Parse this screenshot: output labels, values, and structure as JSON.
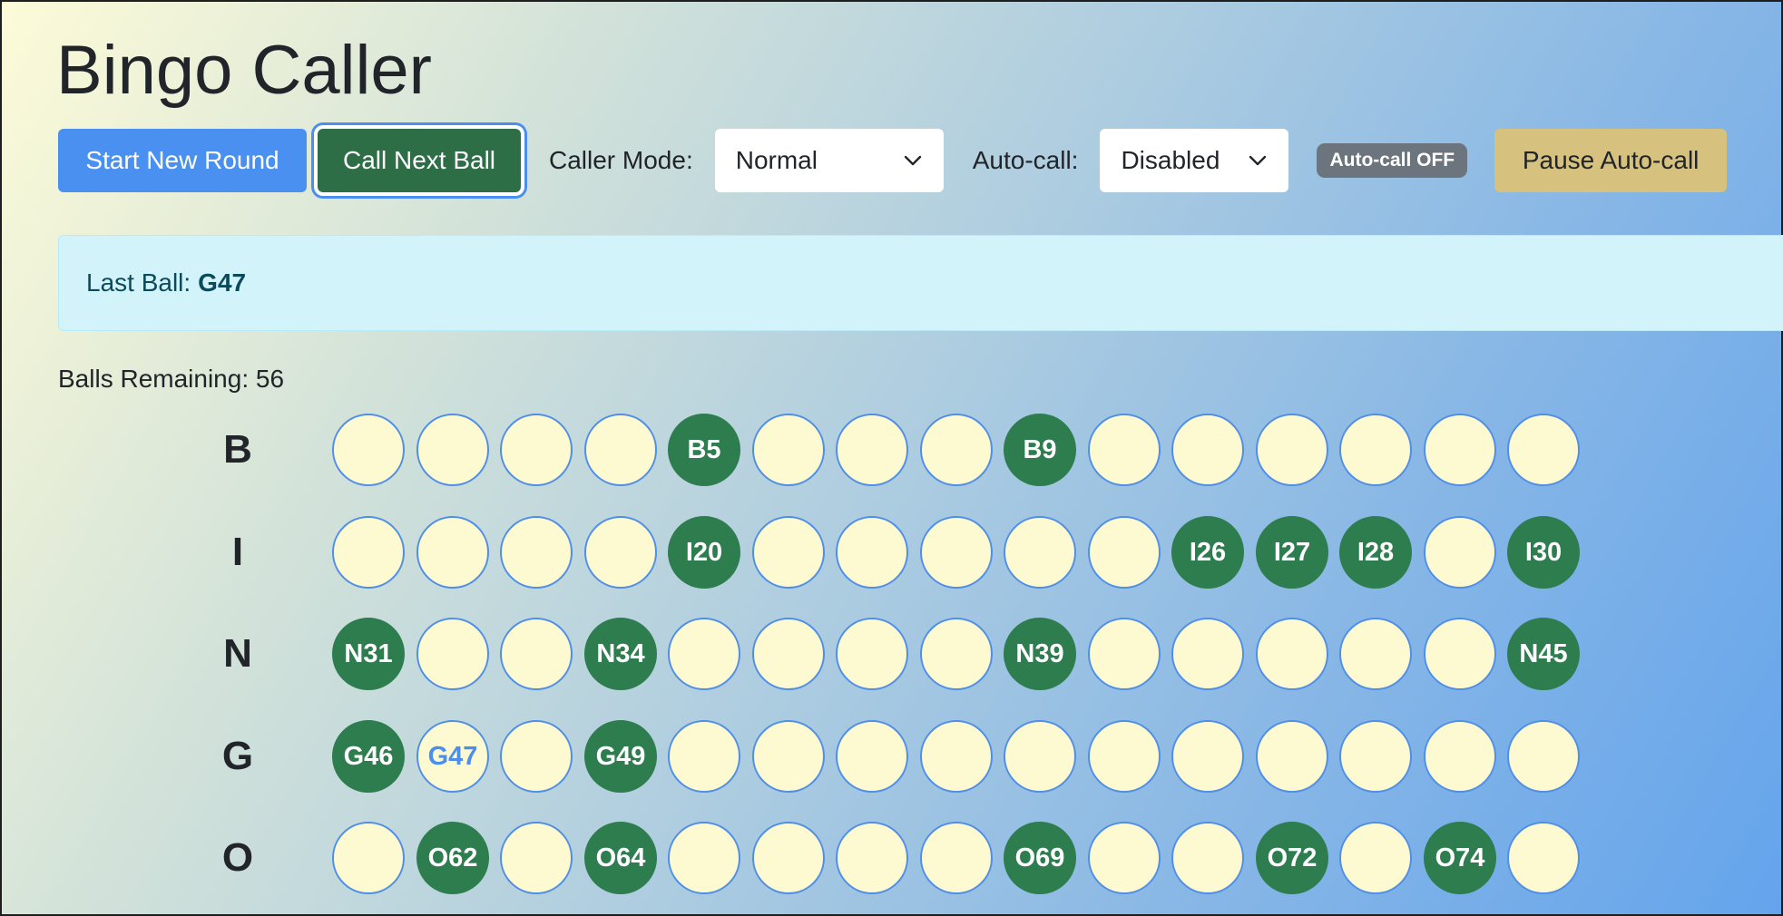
{
  "title": "Bingo Caller",
  "toolbar": {
    "start_label": "Start New Round",
    "call_label": "Call Next Ball",
    "mode_label": "Caller Mode:",
    "mode_value": "Normal",
    "auto_label": "Auto-call:",
    "auto_value": "Disabled",
    "auto_badge": "Auto-call OFF",
    "pause_label": "Pause Auto-call"
  },
  "status": {
    "last_ball_label": "Last Ball:",
    "last_ball_value": "G47",
    "remaining_text": "Balls Remaining: 56"
  },
  "colors": {
    "called_ball": "#2e7d4f",
    "uncalled_ball": "#fdf9d0",
    "ball_outline": "#4f8fe8",
    "primary_button": "#4a90f0",
    "success_button": "#2e6e47",
    "warning_button": "#d6c17f"
  },
  "icons": {
    "select_arrow": "chevron-down-icon"
  },
  "board": {
    "rows": [
      {
        "letter": "B",
        "balls": [
          {
            "label": "",
            "called": false
          },
          {
            "label": "",
            "called": false
          },
          {
            "label": "",
            "called": false
          },
          {
            "label": "",
            "called": false
          },
          {
            "label": "B5",
            "called": true
          },
          {
            "label": "",
            "called": false
          },
          {
            "label": "",
            "called": false
          },
          {
            "label": "",
            "called": false
          },
          {
            "label": "B9",
            "called": true
          },
          {
            "label": "",
            "called": false
          },
          {
            "label": "",
            "called": false
          },
          {
            "label": "",
            "called": false
          },
          {
            "label": "",
            "called": false
          },
          {
            "label": "",
            "called": false
          },
          {
            "label": "",
            "called": false
          }
        ]
      },
      {
        "letter": "I",
        "balls": [
          {
            "label": "",
            "called": false
          },
          {
            "label": "",
            "called": false
          },
          {
            "label": "",
            "called": false
          },
          {
            "label": "",
            "called": false
          },
          {
            "label": "I20",
            "called": true
          },
          {
            "label": "",
            "called": false
          },
          {
            "label": "",
            "called": false
          },
          {
            "label": "",
            "called": false
          },
          {
            "label": "",
            "called": false
          },
          {
            "label": "",
            "called": false
          },
          {
            "label": "I26",
            "called": true
          },
          {
            "label": "I27",
            "called": true
          },
          {
            "label": "I28",
            "called": true
          },
          {
            "label": "",
            "called": false
          },
          {
            "label": "I30",
            "called": true
          }
        ]
      },
      {
        "letter": "N",
        "balls": [
          {
            "label": "N31",
            "called": true
          },
          {
            "label": "",
            "called": false
          },
          {
            "label": "",
            "called": false
          },
          {
            "label": "N34",
            "called": true
          },
          {
            "label": "",
            "called": false
          },
          {
            "label": "",
            "called": false
          },
          {
            "label": "",
            "called": false
          },
          {
            "label": "",
            "called": false
          },
          {
            "label": "N39",
            "called": true
          },
          {
            "label": "",
            "called": false
          },
          {
            "label": "",
            "called": false
          },
          {
            "label": "",
            "called": false
          },
          {
            "label": "",
            "called": false
          },
          {
            "label": "",
            "called": false
          },
          {
            "label": "N45",
            "called": true
          }
        ]
      },
      {
        "letter": "G",
        "balls": [
          {
            "label": "G46",
            "called": true
          },
          {
            "label": "G47",
            "called": false
          },
          {
            "label": "",
            "called": false
          },
          {
            "label": "G49",
            "called": true
          },
          {
            "label": "",
            "called": false
          },
          {
            "label": "",
            "called": false
          },
          {
            "label": "",
            "called": false
          },
          {
            "label": "",
            "called": false
          },
          {
            "label": "",
            "called": false
          },
          {
            "label": "",
            "called": false
          },
          {
            "label": "",
            "called": false
          },
          {
            "label": "",
            "called": false
          },
          {
            "label": "",
            "called": false
          },
          {
            "label": "",
            "called": false
          },
          {
            "label": "",
            "called": false
          }
        ]
      },
      {
        "letter": "O",
        "balls": [
          {
            "label": "",
            "called": false
          },
          {
            "label": "O62",
            "called": true
          },
          {
            "label": "",
            "called": false
          },
          {
            "label": "O64",
            "called": true
          },
          {
            "label": "",
            "called": false
          },
          {
            "label": "",
            "called": false
          },
          {
            "label": "",
            "called": false
          },
          {
            "label": "",
            "called": false
          },
          {
            "label": "O69",
            "called": true
          },
          {
            "label": "",
            "called": false
          },
          {
            "label": "",
            "called": false
          },
          {
            "label": "O72",
            "called": true
          },
          {
            "label": "",
            "called": false
          },
          {
            "label": "O74",
            "called": true
          },
          {
            "label": "",
            "called": false
          }
        ]
      }
    ]
  }
}
